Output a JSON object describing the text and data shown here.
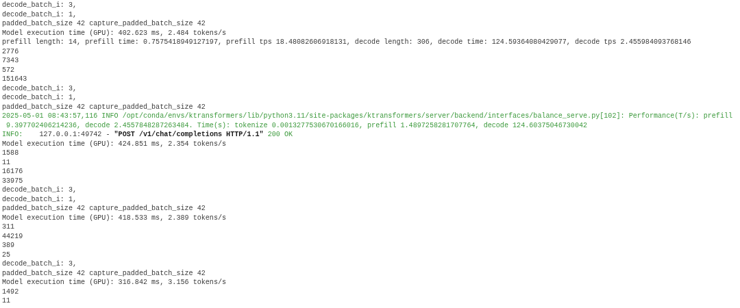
{
  "terminal": {
    "lines": [
      {
        "kind": "plain",
        "text": "decode_batch_i: 3,"
      },
      {
        "kind": "plain",
        "text": "decode_batch_i: 1,"
      },
      {
        "kind": "plain",
        "text": "padded_batch_size 42 capture_padded_batch_size 42"
      },
      {
        "kind": "plain",
        "text": "Model execution time (GPU): 402.623 ms, 2.484 tokens/s"
      },
      {
        "kind": "plain",
        "text": "prefill length: 14, prefill time: 0.7575418949127197, prefill tps 18.48082606918131, decode length: 306, decode time: 124.59364080429077, decode tps 2.455984093768146"
      },
      {
        "kind": "plain",
        "text": "2776"
      },
      {
        "kind": "plain",
        "text": "7343"
      },
      {
        "kind": "plain",
        "text": "572"
      },
      {
        "kind": "plain",
        "text": "151643"
      },
      {
        "kind": "plain",
        "text": "decode_batch_i: 3,"
      },
      {
        "kind": "plain",
        "text": "decode_batch_i: 1,"
      },
      {
        "kind": "plain",
        "text": "padded_batch_size 42 capture_padded_batch_size 42"
      },
      {
        "kind": "log",
        "text": "2025-05-01 08:43:57,116 INFO /opt/conda/envs/ktransformers/lib/python3.11/site-packages/ktransformers/server/backend/interfaces/balance_serve.py[102]: Performance(T/s): prefill"
      },
      {
        "kind": "log",
        "text": " 9.397702406214236, decode 2.4557848287263484. Time(s): tokenize 0.0013277530670166016, prefill 1.4897258281707764, decode 124.60375046730042"
      },
      {
        "kind": "access",
        "level": "INFO:",
        "client": "    127.0.0.1:49742 - ",
        "request": "\"POST /v1/chat/completions HTTP/1.1\"",
        "status": "200 OK"
      },
      {
        "kind": "plain",
        "text": "Model execution time (GPU): 424.851 ms, 2.354 tokens/s"
      },
      {
        "kind": "plain",
        "text": "1588"
      },
      {
        "kind": "plain",
        "text": "11"
      },
      {
        "kind": "plain",
        "text": "16176"
      },
      {
        "kind": "plain",
        "text": "33975"
      },
      {
        "kind": "plain",
        "text": "decode_batch_i: 3,"
      },
      {
        "kind": "plain",
        "text": "decode_batch_i: 1,"
      },
      {
        "kind": "plain",
        "text": "padded_batch_size 42 capture_padded_batch_size 42"
      },
      {
        "kind": "plain",
        "text": "Model execution time (GPU): 418.533 ms, 2.389 tokens/s"
      },
      {
        "kind": "plain",
        "text": "311"
      },
      {
        "kind": "plain",
        "text": "44219"
      },
      {
        "kind": "plain",
        "text": "389"
      },
      {
        "kind": "plain",
        "text": "25"
      },
      {
        "kind": "plain",
        "text": "decode_batch_i: 3,"
      },
      {
        "kind": "plain",
        "text": "padded_batch_size 42 capture_padded_batch_size 42"
      },
      {
        "kind": "plain",
        "text": "Model execution time (GPU): 316.842 ms, 3.156 tokens/s"
      },
      {
        "kind": "plain",
        "text": "1492"
      },
      {
        "kind": "plain",
        "text": "11"
      }
    ]
  }
}
